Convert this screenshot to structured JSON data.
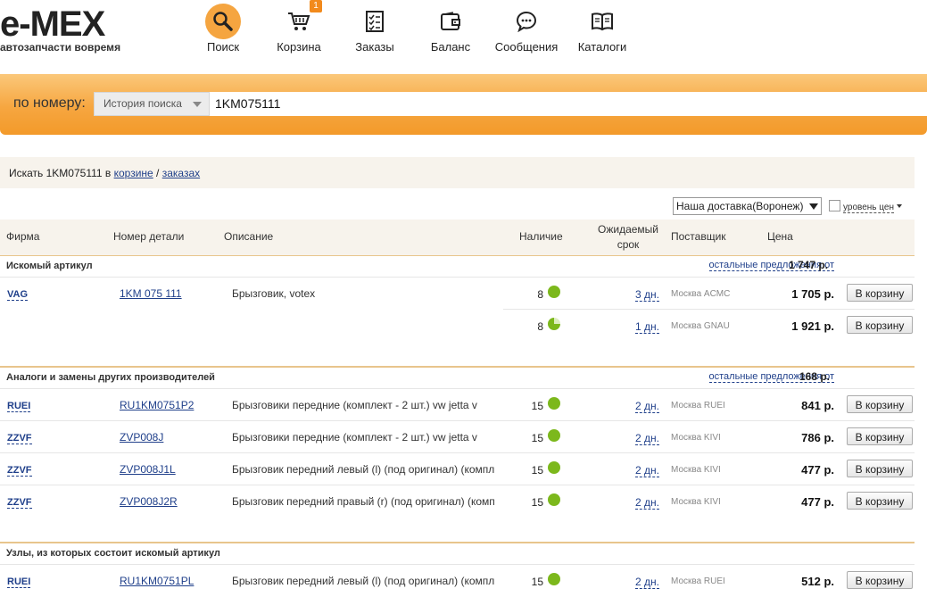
{
  "logo": {
    "word": "e-MEX",
    "tagline": "автозапчасти вовремя"
  },
  "nav": [
    {
      "label": "Поиск",
      "icon": "magnifier-icon",
      "active": true
    },
    {
      "label": "Корзина",
      "icon": "cart-icon",
      "badge": "1"
    },
    {
      "label": "Заказы",
      "icon": "orders-icon"
    },
    {
      "label": "Баланс",
      "icon": "wallet-icon"
    },
    {
      "label": "Сообщения",
      "icon": "messages-icon"
    },
    {
      "label": "Каталоги",
      "icon": "catalog-book-icon"
    }
  ],
  "search": {
    "label": "по номеру:",
    "history_label": "История поиска",
    "value": "1KM075111"
  },
  "search_strip": {
    "prefix": "Искать 1KM075111 в ",
    "cart_link": "корзине",
    "sep": " / ",
    "orders_link": "заказах"
  },
  "delivery": {
    "selected": "Наша доставка(Воронеж)",
    "price_level_label": "уровень цен"
  },
  "columns": {
    "firm": "Фирма",
    "part_number": "Номер детали",
    "description": "Описание",
    "availability": "Наличие",
    "expected_line1": "Ожидаемый",
    "expected_line2": "срок",
    "supplier": "Поставщик",
    "price": "Цена"
  },
  "sections": [
    {
      "title": "Искомый артикул",
      "others_label": "остальные предложения от",
      "others_price": "1 747 р."
    },
    {
      "title": "Аналоги и замены других производителей",
      "others_label": "остальные предложения от",
      "others_price": "168 р."
    },
    {
      "title": "Узлы, из которых состоит искомый артикул"
    }
  ],
  "rows": [
    {
      "brand": "VAG",
      "part": "1KM 075 111",
      "desc": "Брызговик, votex",
      "qty": "8",
      "days": "3 дн.",
      "supplier": "Москва ACMC",
      "price": "1 705 р.",
      "button": "В корзину"
    },
    {
      "qty": "8",
      "days": "1 дн.",
      "supplier": "Москва GNAU",
      "price": "1 921 р.",
      "button": "В корзину"
    },
    {
      "brand": "RUEI",
      "part": "RU1KM0751P2",
      "desc": "Брызговики передние (комплект - 2 шт.) vw jetta v",
      "qty": "15",
      "days": "2 дн.",
      "supplier": "Москва RUEI",
      "price": "841 р.",
      "button": "В корзину"
    },
    {
      "brand": "ZZVF",
      "part": "ZVP008J",
      "desc": "Брызговики передние (комплект - 2 шт.) vw jetta v",
      "qty": "15",
      "days": "2 дн.",
      "supplier": "Москва KIVI",
      "price": "786 р.",
      "button": "В корзину"
    },
    {
      "brand": "ZZVF",
      "part": "ZVP008J1L",
      "desc": "Брызговик передний левый (l) (под оригинал) (компл",
      "qty": "15",
      "days": "2 дн.",
      "supplier": "Москва KIVI",
      "price": "477 р.",
      "button": "В корзину"
    },
    {
      "brand": "ZZVF",
      "part": "ZVP008J2R",
      "desc": "Брызговик передний правый (r) (под оригинал) (комп",
      "qty": "15",
      "days": "2 дн.",
      "supplier": "Москва KIVI",
      "price": "477 р.",
      "button": "В корзину"
    },
    {
      "brand": "RUEI",
      "part": "RU1KM0751PL",
      "desc": "Брызговик передний левый (l) (под оригинал) (компл",
      "qty": "15",
      "days": "2 дн.",
      "supplier": "Москва RUEI",
      "price": "512 р.",
      "button": "В корзину"
    }
  ]
}
